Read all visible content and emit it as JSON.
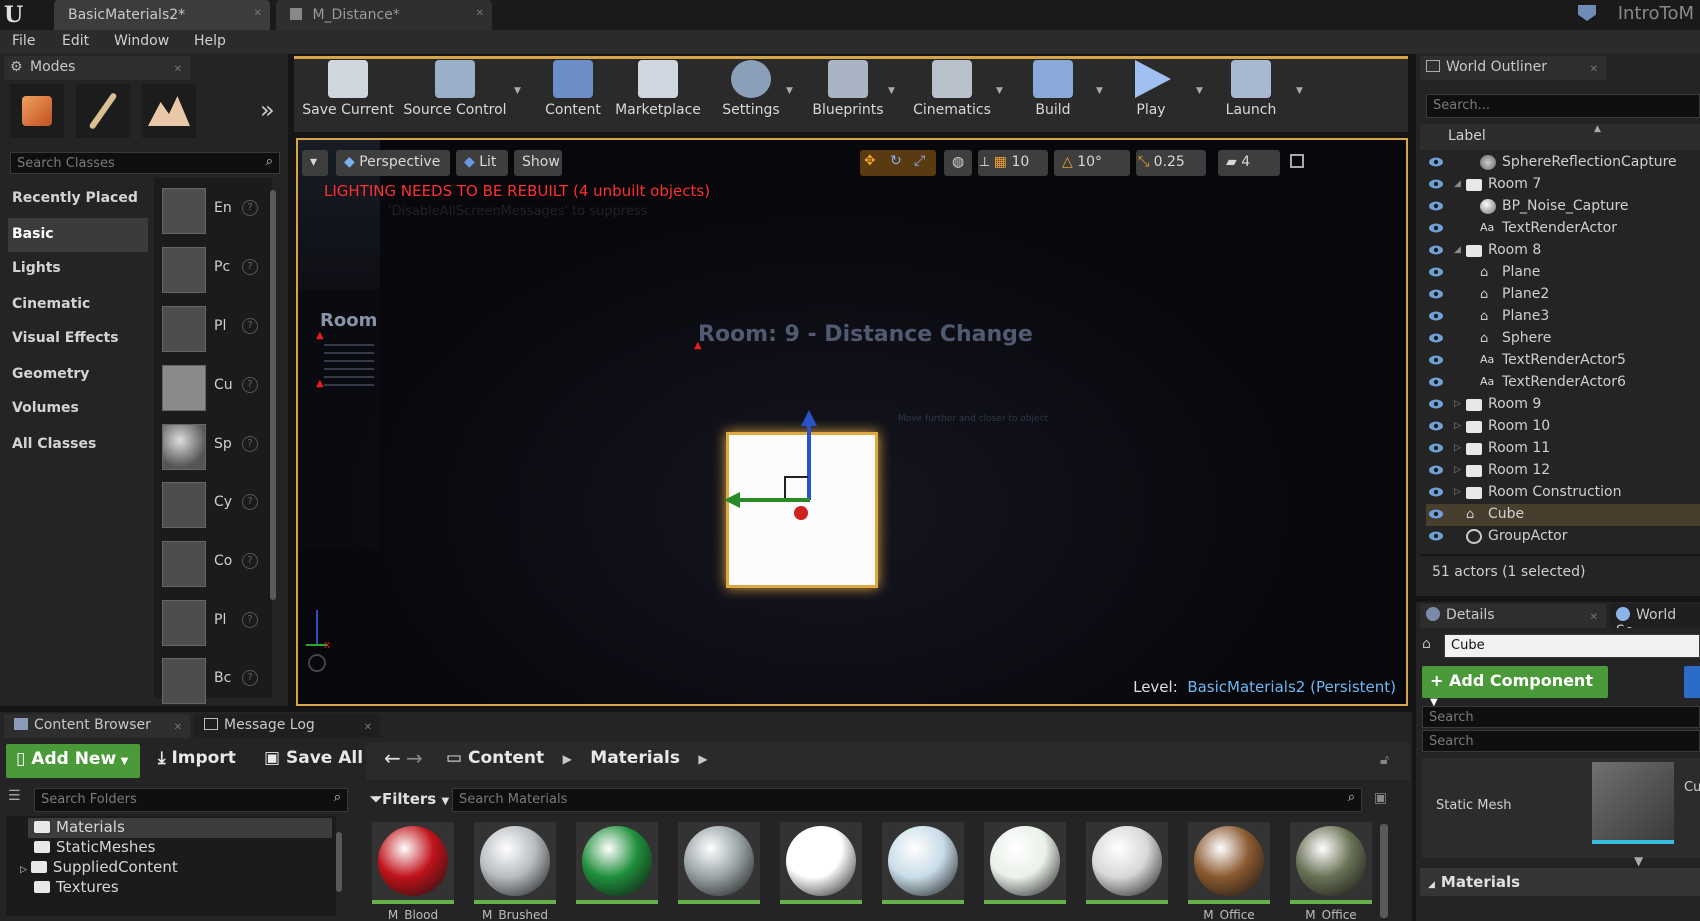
{
  "title_bar": {
    "logo": "U",
    "tabs": [
      {
        "label": "BasicMaterials2*",
        "active": true
      },
      {
        "label": "M_Distance*",
        "active": false
      }
    ],
    "right_text": "IntroToM"
  },
  "menu": [
    "File",
    "Edit",
    "Window",
    "Help"
  ],
  "modes_panel": {
    "tab_label": "Modes",
    "search_placeholder": "Search Classes",
    "categories": [
      "Recently Placed",
      "Basic",
      "Lights",
      "Cinematic",
      "Visual Effects",
      "Geometry",
      "Volumes",
      "All Classes"
    ],
    "selected_category": "Basic",
    "place_items": [
      "En",
      "Pc",
      "Pl",
      "Cu",
      "Sp",
      "Cy",
      "Co",
      "Pl",
      "Bc"
    ]
  },
  "toolbar": {
    "buttons": [
      "Save Current",
      "Source Control",
      "Content",
      "Marketplace",
      "Settings",
      "Blueprints",
      "Cinematics",
      "Build",
      "Play",
      "Launch"
    ]
  },
  "viewport": {
    "view_mode": "Perspective",
    "lighting": "Lit",
    "show": "Show",
    "grid_snap": "10",
    "rot_snap": "10°",
    "scale_snap": "0.25",
    "camera_speed": "4",
    "warning": "LIGHTING NEEDS TO BE REBUILT (4 unbuilt objects)",
    "warning_sub": "'DisableAllScreenMessages' to suppress",
    "room_sign": "Room",
    "room_title": "Room: 9 - Distance Change",
    "hint_text": "Move further and closer to object",
    "level_label": "Level:",
    "level_name": "BasicMaterials2 (Persistent)"
  },
  "outliner": {
    "tab_label": "World Outliner",
    "search_placeholder": "Search...",
    "column": "Label",
    "rows": [
      {
        "label": "SphereReflectionCapture",
        "indent": 2,
        "icon": "reflection"
      },
      {
        "label": "Room 7",
        "indent": 1,
        "icon": "folder",
        "expanded": true
      },
      {
        "label": "BP_Noise_Capture",
        "indent": 2,
        "icon": "sphere"
      },
      {
        "label": "TextRenderActor",
        "indent": 2,
        "icon": "text"
      },
      {
        "label": "Room 8",
        "indent": 1,
        "icon": "folder",
        "expanded": true
      },
      {
        "label": "Plane",
        "indent": 2,
        "icon": "mesh"
      },
      {
        "label": "Plane2",
        "indent": 2,
        "icon": "mesh"
      },
      {
        "label": "Plane3",
        "indent": 2,
        "icon": "mesh"
      },
      {
        "label": "Sphere",
        "indent": 2,
        "icon": "mesh"
      },
      {
        "label": "TextRenderActor5",
        "indent": 2,
        "icon": "text"
      },
      {
        "label": "TextRenderActor6",
        "indent": 2,
        "icon": "text"
      },
      {
        "label": "Room 9",
        "indent": 1,
        "icon": "folder",
        "expanded": false
      },
      {
        "label": "Room 10",
        "indent": 1,
        "icon": "folder",
        "expanded": false
      },
      {
        "label": "Room 11",
        "indent": 1,
        "icon": "folder",
        "expanded": false
      },
      {
        "label": "Room 12",
        "indent": 1,
        "icon": "folder",
        "expanded": false
      },
      {
        "label": "Room Construction",
        "indent": 1,
        "icon": "folder",
        "expanded": false
      },
      {
        "label": "Cube",
        "indent": 1,
        "icon": "mesh",
        "selected": true
      },
      {
        "label": "GroupActor",
        "indent": 1,
        "icon": "group"
      }
    ],
    "status": "51 actors (1 selected)"
  },
  "details": {
    "tab_label": "Details",
    "tab2_label": "World Se",
    "name_value": "Cube",
    "add_component": "+ Add Component",
    "search1": "Search",
    "search2": "Search",
    "static_mesh_label": "Static Mesh",
    "static_mesh_partial": "Cu",
    "materials_label": "Materials"
  },
  "content_browser": {
    "tab_label": "Content Browser",
    "tab2_label": "Message Log",
    "add_new": "Add New",
    "import": "Import",
    "save_all": "Save All",
    "path": [
      "Content",
      "Materials"
    ],
    "search_folders_placeholder": "Search Folders",
    "filters": "Filters",
    "search_materials_placeholder": "Search Materials",
    "folders": [
      "Materials",
      "StaticMeshes",
      "SuppliedContent",
      "Textures"
    ],
    "assets": [
      {
        "label": "M_Blood",
        "color": "#c0121a"
      },
      {
        "label": "M_Brushed",
        "color": "#b7bcc0"
      },
      {
        "label": "",
        "color": "#1f8f3c"
      },
      {
        "label": "",
        "color": "#9aa4a6"
      },
      {
        "label": "",
        "color": "#ffffff"
      },
      {
        "label": "",
        "color": "#c8dde8"
      },
      {
        "label": "",
        "color": "#eaf0ea"
      },
      {
        "label": "",
        "color": "#d8d8d8"
      },
      {
        "label": "M_Office",
        "color": "#8a5a30"
      },
      {
        "label": "M_Office",
        "color": "#6a7256"
      }
    ]
  }
}
